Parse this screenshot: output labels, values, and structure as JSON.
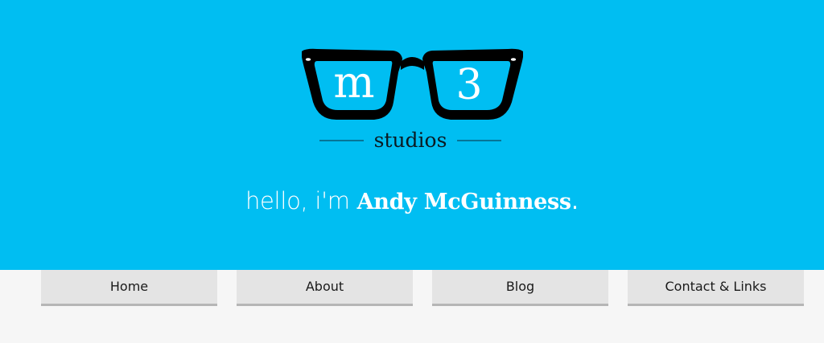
{
  "hero": {
    "background_color": "#00bef2",
    "logo": {
      "left_lens_text": "m",
      "right_lens_text": "3",
      "wordmark": "studios",
      "frame_color": "#000000"
    },
    "greeting": {
      "prefix": "hello, i'm ",
      "name": "Andy McGuinness",
      "suffix": "."
    }
  },
  "nav": {
    "items": [
      {
        "label": "Home"
      },
      {
        "label": "About"
      },
      {
        "label": "Blog"
      },
      {
        "label": "Contact & Links"
      }
    ]
  }
}
